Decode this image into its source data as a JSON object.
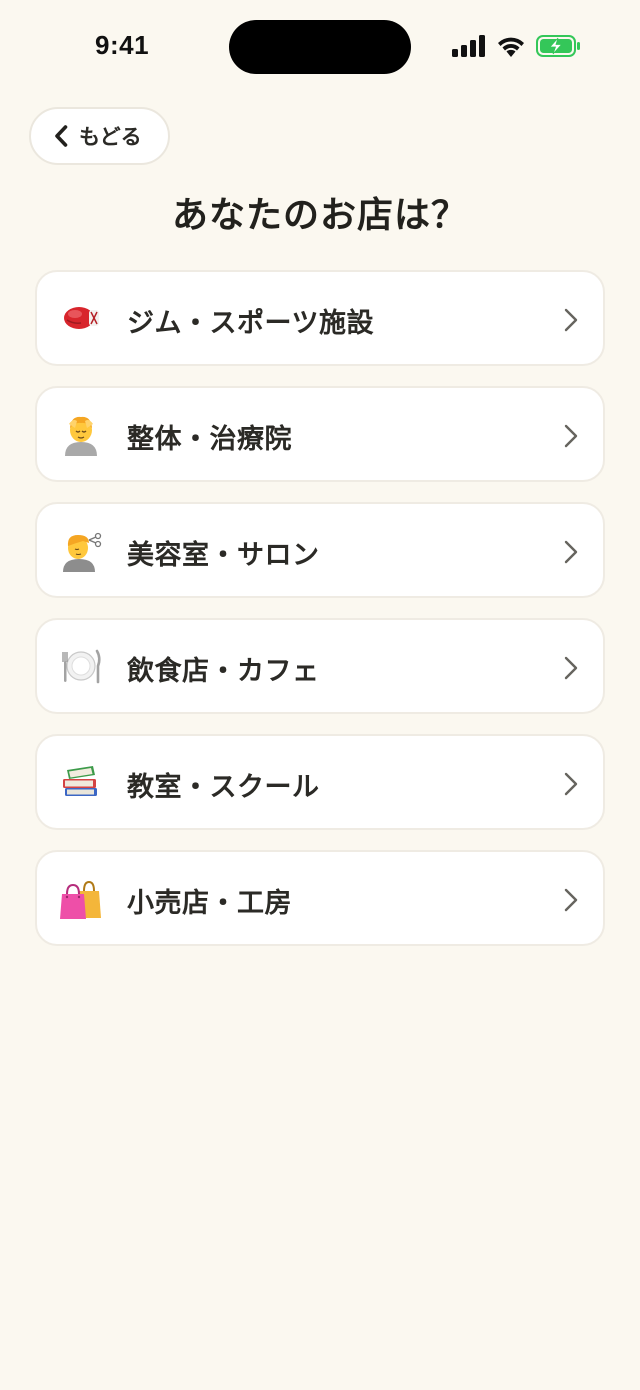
{
  "status_bar": {
    "time": "9:41"
  },
  "nav": {
    "back_label": "もどる"
  },
  "page": {
    "title": "あなたのお店は？"
  },
  "options": [
    {
      "label": "ジム・スポーツ施設",
      "icon": "boxing-glove-icon"
    },
    {
      "label": "整体・治療院",
      "icon": "person-getting-massage-icon"
    },
    {
      "label": "美容室・サロン",
      "icon": "person-getting-haircut-icon"
    },
    {
      "label": "飲食店・カフェ",
      "icon": "fork-knife-plate-icon"
    },
    {
      "label": "教室・スクール",
      "icon": "books-icon"
    },
    {
      "label": "小売店・工房",
      "icon": "shopping-bags-icon"
    }
  ],
  "colors": {
    "background": "#fbf8f0",
    "card": "#ffffff",
    "text": "#2b2a26",
    "battery": "#34c759"
  }
}
